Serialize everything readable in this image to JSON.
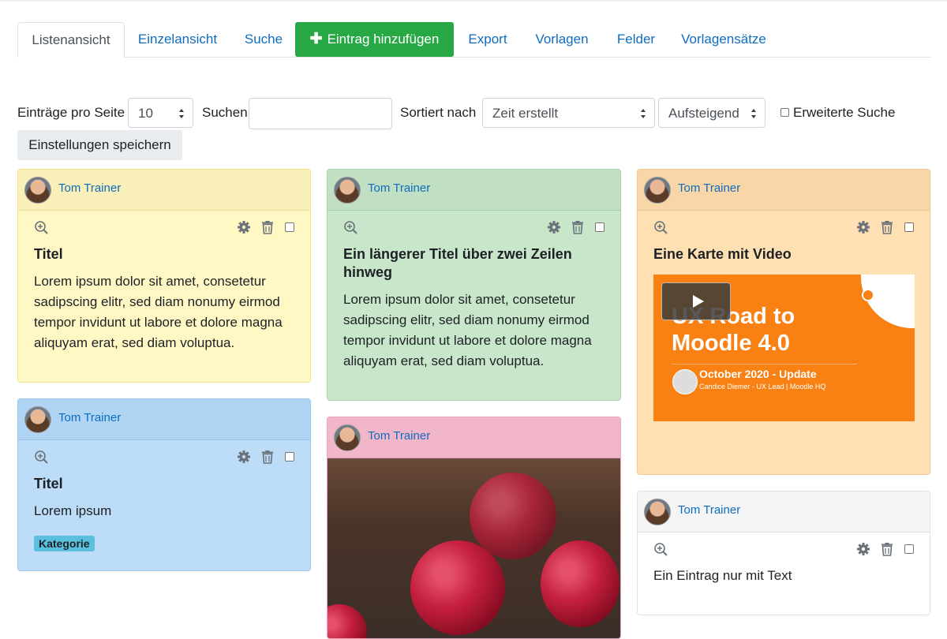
{
  "tabs": [
    {
      "label": "Listenansicht",
      "active": true
    },
    {
      "label": "Einzelansicht"
    },
    {
      "label": "Suche"
    },
    {
      "label": "Eintrag hinzufügen",
      "icon": "plus-icon"
    },
    {
      "label": "Export"
    },
    {
      "label": "Vorlagen"
    },
    {
      "label": "Felder"
    },
    {
      "label": "Vorlagensätze"
    }
  ],
  "controls": {
    "per_page_label": "Einträge pro Seite",
    "per_page_value": "10",
    "search_label": "Suchen",
    "search_value": "",
    "sort_label": "Sortiert nach",
    "sort_value": "Zeit erstellt",
    "order_value": "Aufsteigend",
    "advanced_label": "Erweiterte Suche",
    "advanced_checked": false,
    "save_button": "Einstellungen speichern"
  },
  "cards": [
    {
      "author": "Tom Trainer",
      "title": "Titel",
      "text": "Lorem ipsum dolor sit amet, consetetur sadipscing elitr, sed diam nonumy eirmod tempor invidunt ut labore et dolore magna aliquyam erat, sed diam voluptua.",
      "color": "#fff8c4"
    },
    {
      "author": "Tom Trainer",
      "title": "Titel",
      "text": "Lorem ipsum",
      "badge": "Kategorie",
      "color": "#bcdcf7"
    },
    {
      "author": "Tom Trainer",
      "title": "Ein längerer Titel über zwei Zeilen hinweg",
      "text": "Lorem ipsum dolor sit amet, consetetur sadipscing elitr, sed diam nonumy eirmod tempor invidunt ut labore et dolore magna aliquyam erat, sed diam voluptua.",
      "color": "#c8e6c9"
    },
    {
      "author": "Tom Trainer",
      "image": "raspberries",
      "color": "#f8d7e3"
    },
    {
      "author": "Tom Trainer",
      "title": "Eine Karte mit Video",
      "video": {
        "title_line1": "UX Road to",
        "title_line2": "Moodle 4.0",
        "subtitle": "October 2020 - Update",
        "byline": "Candice Diemer - UX Lead | Moodle HQ"
      },
      "color": "#ffe0b2"
    },
    {
      "author": "Tom Trainer",
      "text": "Ein Eintrag nur mit Text",
      "color": "#ffffff"
    }
  ],
  "icons": {
    "view": "zoom-in-icon",
    "edit": "gear-icon",
    "delete": "trash-icon",
    "select": "checkbox"
  }
}
